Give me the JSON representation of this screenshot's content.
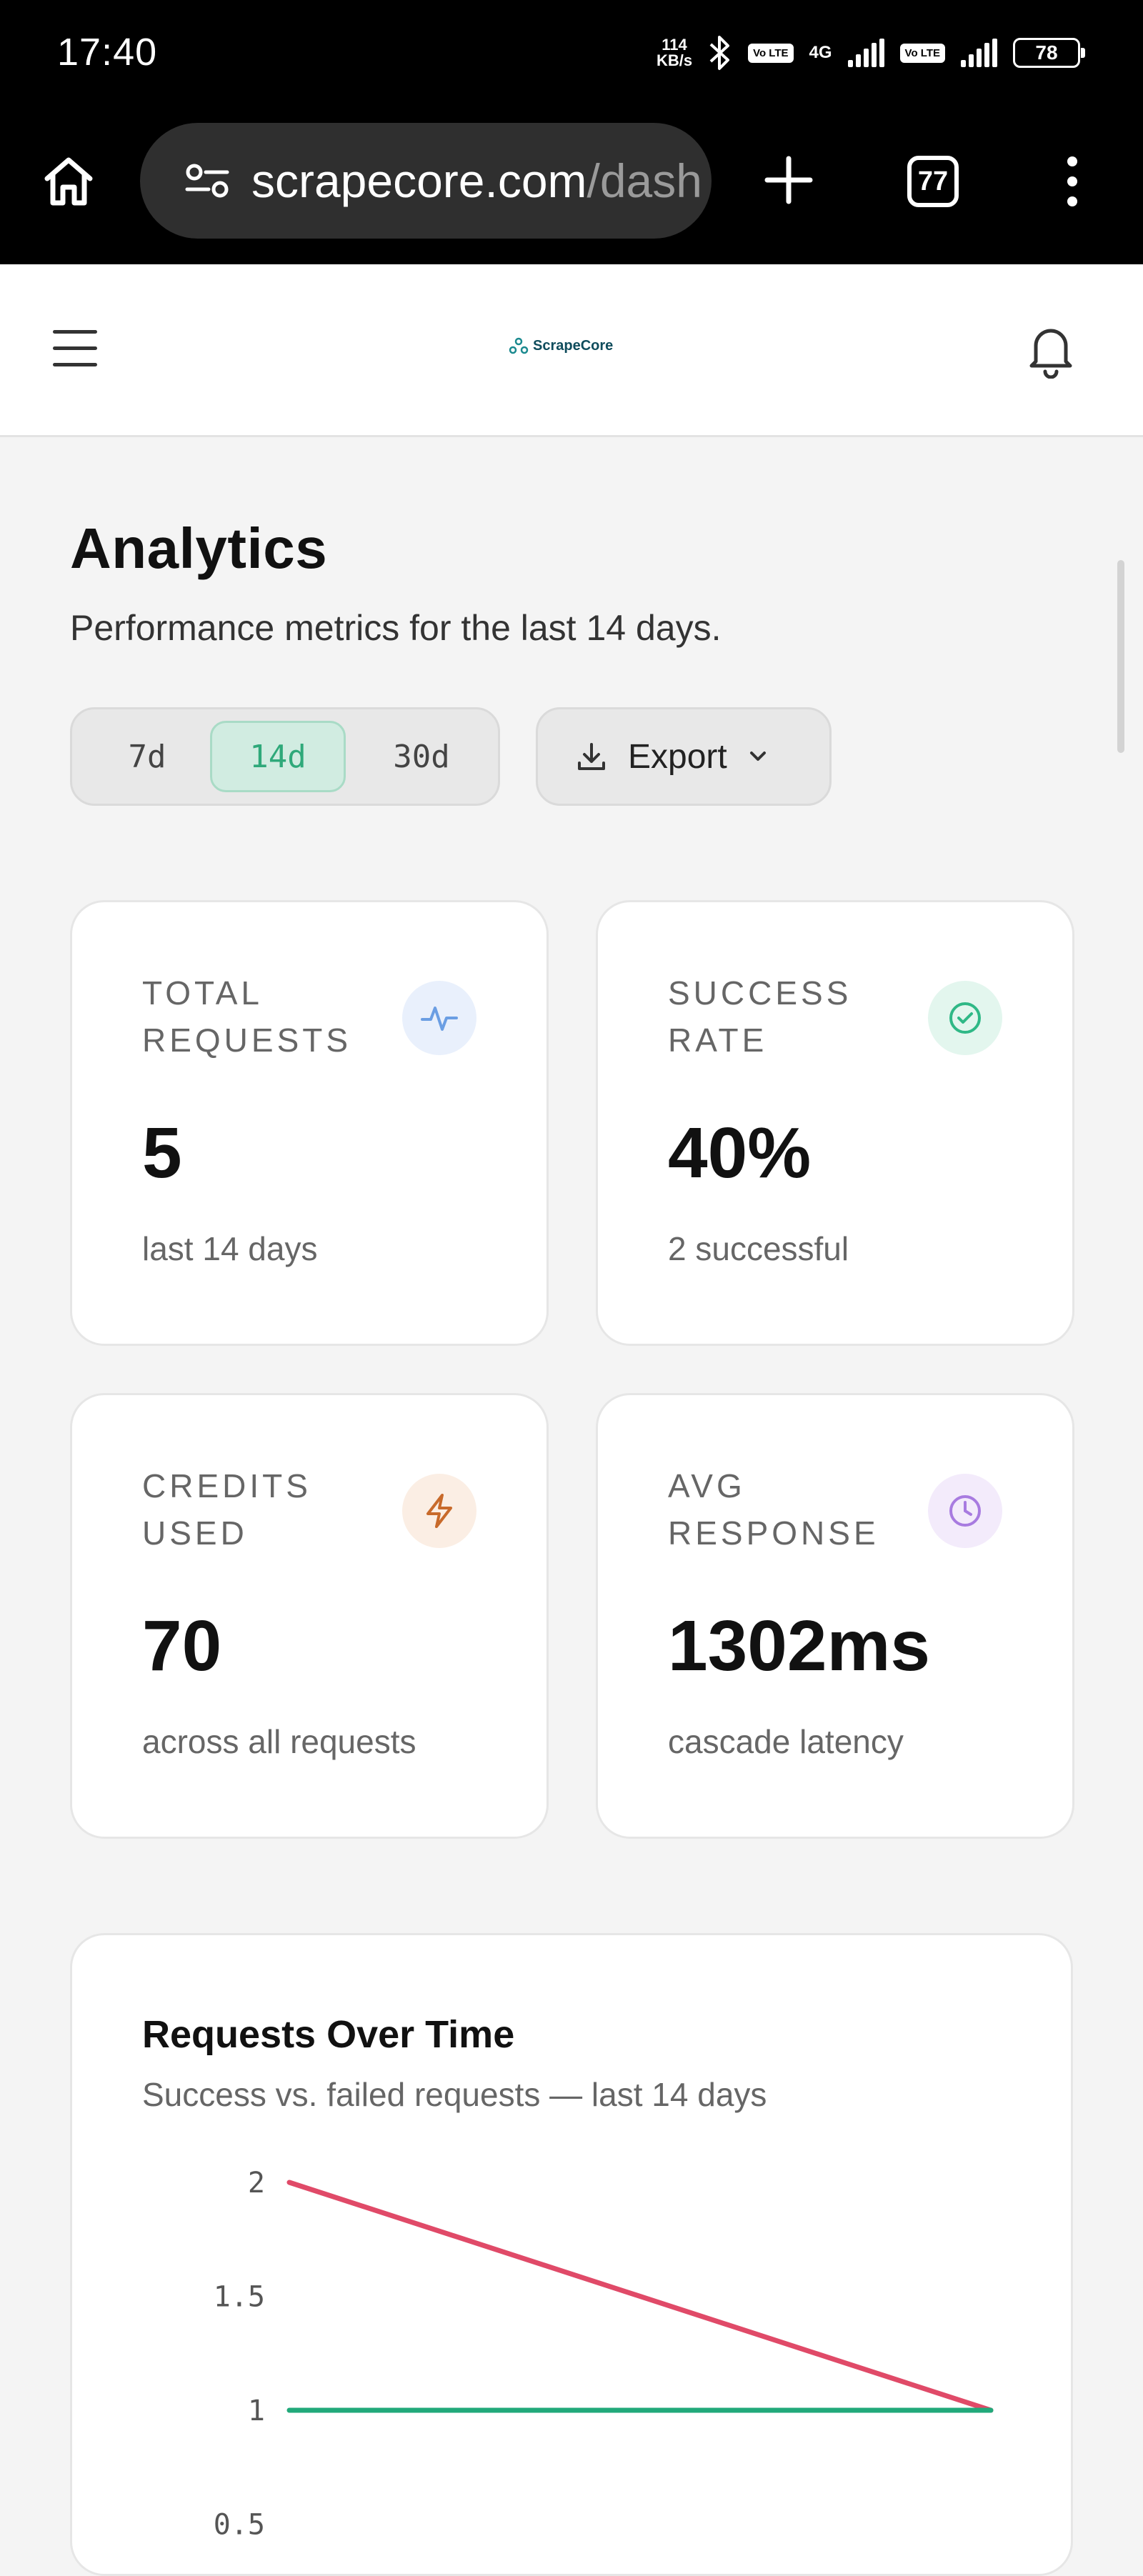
{
  "status_bar": {
    "time": "17:40",
    "net_speed_value": "114",
    "net_speed_unit": "KB/s",
    "volte_chip_1": "Vo LTE",
    "network_type": "4G",
    "volte_chip_2": "Vo LTE",
    "battery": "78"
  },
  "browser": {
    "url_host": "scrapecore.com",
    "url_path": "/dash",
    "tab_count": "77"
  },
  "app": {
    "logo_text": "ScrapeCore"
  },
  "page": {
    "title": "Analytics",
    "subtitle": "Performance metrics for the last 14 days.",
    "ranges": [
      {
        "label": "7d",
        "active": false
      },
      {
        "label": "14d",
        "active": true
      },
      {
        "label": "30d",
        "active": false
      }
    ],
    "export_label": "Export"
  },
  "cards": [
    {
      "label": "TOTAL REQUESTS",
      "value": "5",
      "note": "last 14 days",
      "icon": "activity-icon",
      "accent": "#6b9ee3",
      "icon_bg": "#e9f0fc"
    },
    {
      "label": "SUCCESS RATE",
      "value": "40%",
      "note": "2 successful",
      "icon": "check-circle-icon",
      "accent": "#2fb886",
      "icon_bg": "#e3f6ee"
    },
    {
      "label": "CREDITS USED",
      "value": "70",
      "note": "across all requests",
      "icon": "lightning-icon",
      "accent": "#c86a2b",
      "icon_bg": "#fbeee4"
    },
    {
      "label": "AVG RESPONSE",
      "value": "1302ms",
      "note": "cascade latency",
      "icon": "clock-icon",
      "accent": "#a87be0",
      "icon_bg": "#f3ebfb"
    }
  ],
  "chart": {
    "title": "Requests Over Time",
    "subtitle": "Success vs. failed requests — last 14 days"
  },
  "chart_data": {
    "type": "line",
    "title": "Requests Over Time",
    "subtitle": "Success vs. failed requests — last 14 days",
    "x": [
      0,
      1
    ],
    "ylim": [
      0.5,
      2
    ],
    "yticks": [
      2,
      1.5,
      1,
      0.5
    ],
    "series": [
      {
        "values": [
          2,
          1
        ],
        "color": "#e04a68"
      },
      {
        "values": [
          1,
          1
        ],
        "color": "#21a97a"
      }
    ]
  }
}
